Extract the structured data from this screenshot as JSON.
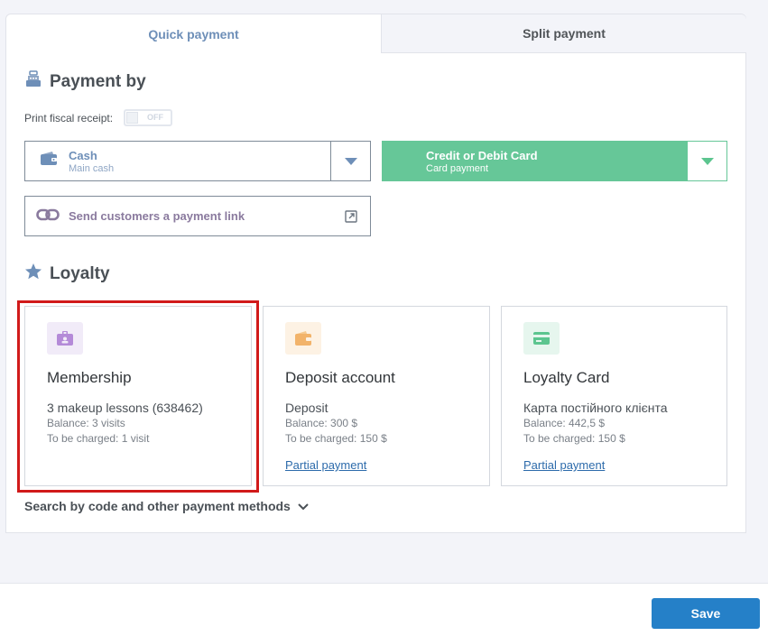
{
  "tabs": [
    {
      "label": "Quick payment",
      "active": true
    },
    {
      "label": "Split payment",
      "active": false
    }
  ],
  "payment": {
    "title": "Payment by",
    "fiscal_label": "Print fiscal receipt:",
    "toggle_state": "OFF",
    "methods": [
      {
        "title": "Cash",
        "subtitle": "Main cash"
      },
      {
        "title": "Credit or Debit Card",
        "subtitle": "Card payment"
      }
    ],
    "link_label": "Send customers a payment link"
  },
  "loyalty": {
    "title": "Loyalty",
    "cards": [
      {
        "title": "Membership",
        "name": "3 makeup lessons (638462)",
        "balance": "Balance: 3 visits",
        "charge": "To be charged: 1 visit"
      },
      {
        "title": "Deposit account",
        "name": "Deposit",
        "balance": "Balance: 300 $",
        "charge": "To be charged: 150 $",
        "link": "Partial payment"
      },
      {
        "title": "Loyalty Card",
        "name": "Карта постійного клієнта",
        "balance": "Balance: 442,5 $",
        "charge": "To be charged: 150 $",
        "link": "Partial payment"
      }
    ],
    "search_more": "Search by code and other payment methods"
  },
  "footer": {
    "save_label": "Save"
  },
  "colors": {
    "accent_blue": "#6e8fb8",
    "card_green": "#66c798",
    "save_blue": "#2580c8",
    "highlight_red": "#d11a1a",
    "membership_purple": "#b48ad8",
    "deposit_orange": "#f2b36a",
    "loyalty_green": "#5cc58f"
  }
}
